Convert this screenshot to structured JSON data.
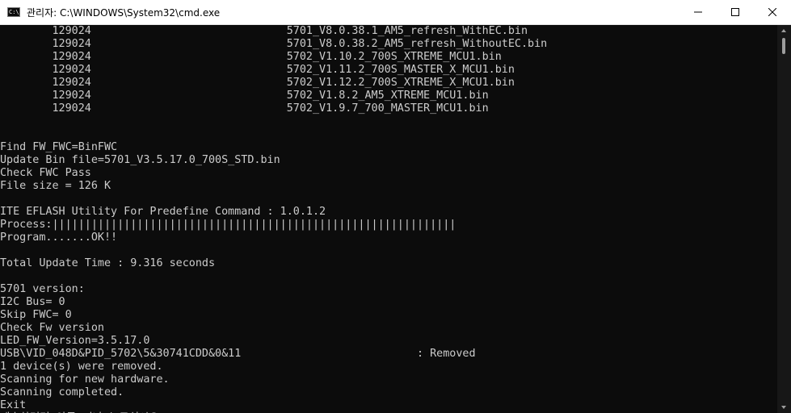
{
  "window": {
    "title": "관리자: C:\\WINDOWS\\System32\\cmd.exe",
    "icon_label": "C:\\_",
    "controls": [
      "minimize-icon",
      "maximize-icon",
      "close-icon"
    ]
  },
  "terminal": {
    "lines": [
      "        129024                              5701_V8.0.38.1_AM5_refresh_WithEC.bin",
      "        129024                              5701_V8.0.38.2_AM5_refresh_WithoutEC.bin",
      "        129024                              5702_V1.10.2_700S_XTREME_MCU1.bin",
      "        129024                              5702_V1.11.2_700S_MASTER_X_MCU1.bin",
      "        129024                              5702_V1.12.2_700S_XTREME_X_MCU1.bin",
      "        129024                              5702_V1.8.2_AM5_XTREME_MCU1.bin",
      "        129024                              5702_V1.9.7_700_MASTER_MCU1.bin",
      "",
      "",
      "Find FW_FWC=BinFWC",
      "Update Bin file=5701_V3.5.17.0_700S_STD.bin",
      "Check FWC Pass",
      "File size = 126 K",
      "",
      "ITE EFLASH Utility For Predefine Command : 1.0.1.2",
      "Process:||||||||||||||||||||||||||||||||||||||||||||||||||||||||||||||",
      "Program.......OK!!",
      "",
      "Total Update Time : 9.316 seconds",
      "",
      "5701 version:",
      "I2C Bus= 0",
      "Skip FWC= 0",
      "Check Fw version",
      "LED_FW_Version=3.5.17.0",
      "USB\\VID_048D&PID_5702\\5&30741CDD&0&11                           : Removed",
      "1 device(s) were removed.",
      "Scanning for new hardware.",
      "Scanning completed.",
      "Exit",
      "계속하려면 아무 키나 누르십시오 . . ."
    ]
  },
  "colors": {
    "background": "#0c0c0c",
    "text": "#cccccc",
    "titlebar": "#ffffff"
  }
}
